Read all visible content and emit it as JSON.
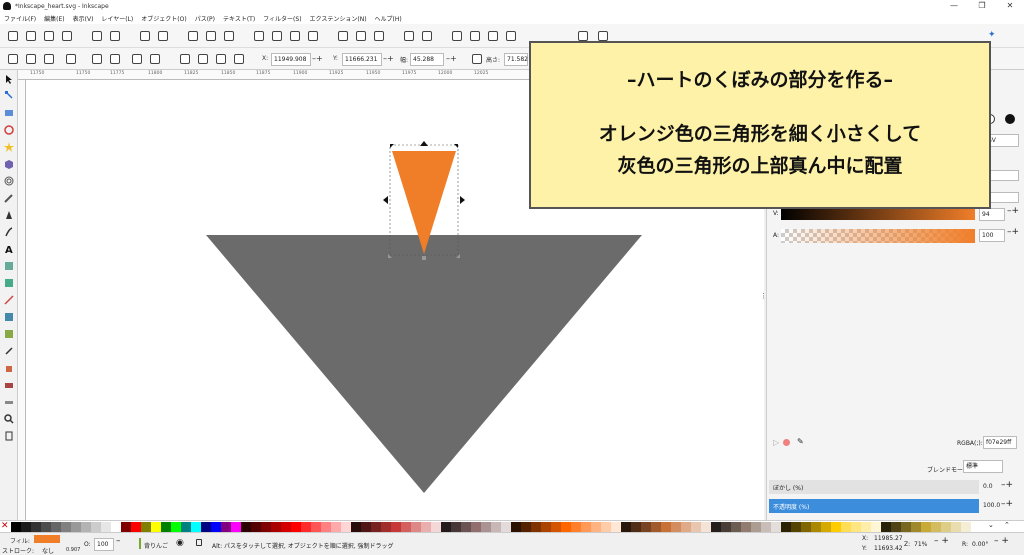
{
  "window": {
    "title": "*Inkscape_heart.svg - Inkscape",
    "buttons": [
      "—",
      "❐",
      "✕"
    ]
  },
  "menu": [
    "ファイル(F)",
    "編集(E)",
    "表示(V)",
    "レイヤー(L)",
    "オブジェクト(O)",
    "パス(P)",
    "テキスト(T)",
    "フィルター(S)",
    "エクステンション(N)",
    "ヘルプ(H)"
  ],
  "toolctl": {
    "x_label": "X:",
    "x_value": "11949.908",
    "y_label": "Y:",
    "y_value": "11666.231",
    "w_label": "幅:",
    "w_value": "45.288",
    "h_label": "高さ:",
    "h_value": "71.582"
  },
  "ruler_top": [
    "11750",
    "11750",
    "11775",
    "11800",
    "11825",
    "11850",
    "11875",
    "11900",
    "11925",
    "11950",
    "11975",
    "12000",
    "12025"
  ],
  "overlay": {
    "heading": "–ハートのくぼみの部分を作る–",
    "line1": "オレンジ色の三角形を細く小さくして",
    "line2": "灰色の三角形の上部真ん中に配置"
  },
  "sidebar": {
    "mode_select": "SV",
    "v_label": "V:",
    "v_value": "94",
    "a_label": "A:",
    "a_value": "100",
    "rgba_label": "RGBA(;):",
    "rgba_value": "f07e29ff",
    "blend_label": "ブレンドモード:",
    "blend_value": "標準",
    "blur_label": "ぼかし (%)",
    "blur_value": "0.0",
    "opacity_label": "不透明度 (%)",
    "opacity_value": "100.0"
  },
  "status": {
    "fill_label": "フィル:",
    "stroke_label": "ストローク:",
    "stroke_value": "なし",
    "stroke_width": "0.907",
    "o_label": "O:",
    "o_value": "100",
    "layer": "背りんご",
    "message": "Alt: パスをタッチして選択, オブジェクトを順に選択, 強制ドラッグ",
    "x_label": "X:",
    "x_value": "11985.27",
    "y_label": "Y:",
    "y_value": "11693.42",
    "zoom_label": "Z:",
    "zoom_value": "71%",
    "rot_label": "R:",
    "rot_value": "0.00°"
  },
  "colors": {
    "orange": "#f07e29",
    "gray": "#6b6b6b",
    "accent_blue": "#3c8ddc",
    "overlay_bg": "#fdf2a8"
  },
  "palette": [
    "#000000",
    "#1a1a1a",
    "#333333",
    "#4d4d4d",
    "#666666",
    "#808080",
    "#999999",
    "#b3b3b3",
    "#cccccc",
    "#e6e6e6",
    "#ffffff",
    "#800000",
    "#ff0000",
    "#808000",
    "#ffff00",
    "#008000",
    "#00ff00",
    "#008080",
    "#00ffff",
    "#000080",
    "#0000ff",
    "#800080",
    "#ff00ff",
    "#2b0000",
    "#550000",
    "#800000",
    "#aa0000",
    "#d40000",
    "#ff0000",
    "#ff2a2a",
    "#ff5555",
    "#ff8080",
    "#ffaaaa",
    "#ffd5d5",
    "#280b0b",
    "#501616",
    "#782121",
    "#a02c2c",
    "#c83737",
    "#d35f5f",
    "#de8787",
    "#e9afaf",
    "#f4d7d7",
    "#241c1c",
    "#483737",
    "#6c5353",
    "#916f6f",
    "#ac9393",
    "#c8b7b7",
    "#e3dbdb",
    "#2b1100",
    "#552200",
    "#803300",
    "#aa4400",
    "#d45500",
    "#ff6600",
    "#ff7f2a",
    "#ff9955",
    "#ffb380",
    "#ffccaa",
    "#ffe6d5",
    "#28170b",
    "#502d16",
    "#784421",
    "#a05a2c",
    "#c87137",
    "#d38d5f",
    "#deaa87",
    "#e9c6af",
    "#f4e3d7",
    "#241f1c",
    "#483e37",
    "#6c5d53",
    "#917c6f",
    "#ac9d93",
    "#c8beb7",
    "#e3dedb",
    "#2b2200",
    "#554400",
    "#806600",
    "#aa8800",
    "#d4aa00",
    "#ffcc00",
    "#ffdd55",
    "#ffe680",
    "#ffeeaa",
    "#fff6d5",
    "#28220b",
    "#504416",
    "#786721",
    "#a0892c",
    "#c8ab37",
    "#d3bc5f",
    "#decd87",
    "#e9ddaf",
    "#f4eed7"
  ]
}
